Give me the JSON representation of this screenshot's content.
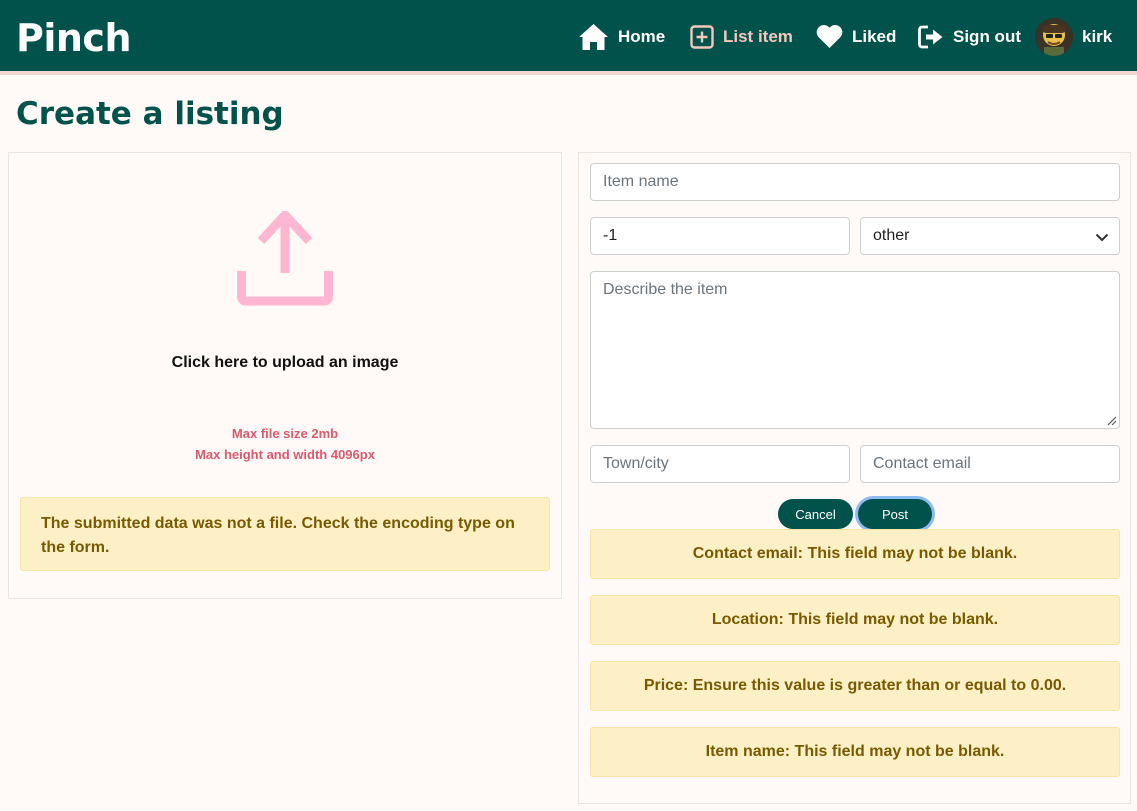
{
  "nav": {
    "brand": "Pinch",
    "items": [
      {
        "label": "Home",
        "icon": "home-icon"
      },
      {
        "label": "List item",
        "icon": "plus-square-icon",
        "active": true
      },
      {
        "label": "Liked",
        "icon": "heart-icon"
      },
      {
        "label": "Sign out",
        "icon": "sign-out-icon"
      }
    ],
    "user": {
      "name": "kirk",
      "icon": "avatar"
    }
  },
  "page": {
    "title": "Create a listing"
  },
  "upload": {
    "icon": "upload-icon",
    "label": "Click here to upload an image",
    "max_size": "Max file size 2mb",
    "max_dims": "Max height and width 4096px",
    "error": "The submitted data was not a file. Check the encoding type on the form."
  },
  "form": {
    "item_name": {
      "placeholder": "Item name",
      "value": ""
    },
    "price": {
      "value": "-1"
    },
    "category": {
      "value": "other"
    },
    "description": {
      "placeholder": "Describe the item",
      "value": ""
    },
    "location": {
      "placeholder": "Town/city",
      "value": ""
    },
    "contact_email": {
      "placeholder": "Contact email",
      "value": ""
    },
    "cancel_label": "Cancel",
    "post_label": "Post"
  },
  "errors": [
    "Contact email: This field may not be blank.",
    "Location: This field may not be blank.",
    "Price: Ensure this value is greater than or equal to 0.00.",
    "Item name: This field may not be blank."
  ],
  "colors": {
    "brand": "#00524a",
    "accent": "#f6c7bb",
    "upload_icon": "#ffb6d0",
    "limit_text": "#e0586c",
    "alert_bg": "#fdf0c7",
    "alert_text": "#7a5a00"
  }
}
